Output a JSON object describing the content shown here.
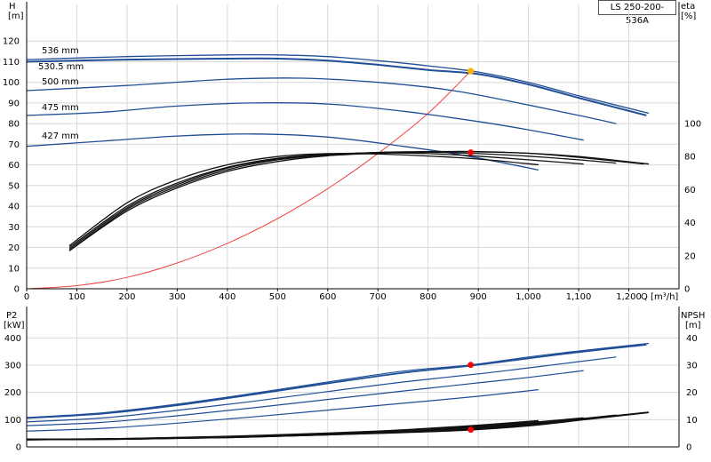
{
  "product_label": "LS 250-200-536A",
  "colors": {
    "curve_blue": "#1f4e96",
    "eff_black": "#111111",
    "system_red": "#ee4444",
    "marker_red": "#ff0000",
    "marker_orange": "#ffb300",
    "grid": "#d8d8d8",
    "axis": "#000000"
  },
  "chart_data": [
    {
      "type": "line",
      "title": "",
      "x_label": "Q [m³/h]",
      "x_ticks": [
        "0",
        "100",
        "200",
        "300",
        "400",
        "500",
        "600",
        "700",
        "800",
        "900",
        "1,000",
        "1,100",
        "1,200"
      ],
      "xlim": [
        0,
        1300
      ],
      "left_axis": {
        "label": "H",
        "unit": "[m]",
        "ticks": [
          "0",
          "10",
          "20",
          "30",
          "40",
          "50",
          "60",
          "70",
          "80",
          "90",
          "100",
          "110",
          "120"
        ],
        "range": [
          0,
          130
        ]
      },
      "right_axis": {
        "label": "eta",
        "unit": "[%]",
        "ticks": [
          "0",
          "20",
          "40",
          "60",
          "80",
          "100"
        ],
        "range": [
          0,
          100
        ]
      },
      "grid": true,
      "head_curves": [
        {
          "name": "536 mm",
          "points": [
            [
              0,
              111
            ],
            [
              200,
              112.5
            ],
            [
              400,
              113.3
            ],
            [
              500,
              113.3
            ],
            [
              600,
              112.5
            ],
            [
              700,
              110.5
            ],
            [
              800,
              108
            ],
            [
              900,
              105
            ],
            [
              1000,
              100
            ],
            [
              1100,
              93.5
            ],
            [
              1240,
              85
            ]
          ]
        },
        {
          "name": "530.5 mm",
          "points": [
            [
              0,
              110
            ],
            [
              200,
              111
            ],
            [
              400,
              111.5
            ],
            [
              500,
              111.5
            ],
            [
              600,
              110.5
            ],
            [
              700,
              108.5
            ],
            [
              800,
              106
            ],
            [
              900,
              104
            ],
            [
              1000,
              99
            ],
            [
              1100,
              92.5
            ],
            [
              1235,
              84
            ]
          ]
        },
        {
          "name": "500 mm",
          "points": [
            [
              0,
              96
            ],
            [
              200,
              98.5
            ],
            [
              400,
              101.5
            ],
            [
              550,
              102
            ],
            [
              700,
              100
            ],
            [
              850,
              96
            ],
            [
              1000,
              89
            ],
            [
              1100,
              84
            ],
            [
              1175,
              80
            ]
          ]
        },
        {
          "name": "475 mm",
          "points": [
            [
              0,
              84
            ],
            [
              150,
              85.5
            ],
            [
              300,
              88.5
            ],
            [
              450,
              90
            ],
            [
              600,
              89.5
            ],
            [
              750,
              86
            ],
            [
              900,
              81
            ],
            [
              1000,
              77
            ],
            [
              1110,
              72
            ]
          ]
        },
        {
          "name": "427 mm",
          "points": [
            [
              0,
              69
            ],
            [
              150,
              71.5
            ],
            [
              300,
              74
            ],
            [
              450,
              75
            ],
            [
              600,
              73.5
            ],
            [
              750,
              69
            ],
            [
              850,
              65.5
            ],
            [
              950,
              61
            ],
            [
              1020,
              57.5
            ]
          ]
        }
      ],
      "efficiency_curves": [
        {
          "points": [
            [
              85,
              23
            ],
            [
              200,
              48
            ],
            [
              300,
              62
            ],
            [
              400,
              72
            ],
            [
              500,
              78
            ],
            [
              600,
              81
            ],
            [
              700,
              82.5
            ],
            [
              800,
              83
            ],
            [
              900,
              83
            ],
            [
              1000,
              82
            ],
            [
              1100,
              80
            ],
            [
              1240,
              75.5
            ]
          ]
        },
        {
          "points": [
            [
              85,
              23
            ],
            [
              200,
              47
            ],
            [
              300,
              61
            ],
            [
              400,
              71
            ],
            [
              500,
              77
            ],
            [
              600,
              80.5
            ],
            [
              700,
              82
            ],
            [
              800,
              82.8
            ],
            [
              900,
              82.8
            ],
            [
              1000,
              82
            ],
            [
              1100,
              79.5
            ],
            [
              1230,
              75.5
            ]
          ]
        },
        {
          "points": [
            [
              85,
              24
            ],
            [
              200,
              49
            ],
            [
              300,
              63
            ],
            [
              400,
              73
            ],
            [
              500,
              78.5
            ],
            [
              600,
              81
            ],
            [
              700,
              82.5
            ],
            [
              800,
              82.6
            ],
            [
              900,
              81.8
            ],
            [
              1000,
              80.2
            ],
            [
              1100,
              78
            ],
            [
              1175,
              76
            ]
          ]
        },
        {
          "points": [
            [
              85,
              25
            ],
            [
              200,
              50
            ],
            [
              300,
              64
            ],
            [
              400,
              73.5
            ],
            [
              500,
              79
            ],
            [
              600,
              81.5
            ],
            [
              700,
              82.2
            ],
            [
              800,
              81.8
            ],
            [
              900,
              80.2
            ],
            [
              1000,
              78
            ],
            [
              1110,
              75.5
            ]
          ]
        },
        {
          "points": [
            [
              85,
              26
            ],
            [
              200,
              52
            ],
            [
              300,
              66
            ],
            [
              400,
              75
            ],
            [
              500,
              80
            ],
            [
              600,
              81.8
            ],
            [
              700,
              81.5
            ],
            [
              800,
              80.3
            ],
            [
              900,
              78.5
            ],
            [
              1020,
              75
            ]
          ]
        }
      ],
      "system_curve": {
        "points": [
          [
            0,
            0
          ],
          [
            100,
            1.5
          ],
          [
            200,
            5.5
          ],
          [
            300,
            12.5
          ],
          [
            400,
            22
          ],
          [
            500,
            34
          ],
          [
            600,
            48.5
          ],
          [
            700,
            65.5
          ],
          [
            800,
            85
          ],
          [
            885,
            105.5
          ]
        ]
      },
      "duty_point": {
        "Q": 885,
        "H": 105.5,
        "eta": 82.5
      }
    },
    {
      "type": "line",
      "title": "",
      "x_label": "",
      "xlim": [
        0,
        1300
      ],
      "left_axis": {
        "label": "P2",
        "unit": "[kW]",
        "ticks": [
          "0",
          "100",
          "200",
          "300",
          "400"
        ],
        "range": [
          0,
          450
        ]
      },
      "right_axis": {
        "label": "NPSH",
        "unit": "[m]",
        "ticks": [
          "0",
          "10",
          "20",
          "30",
          "40"
        ],
        "range": [
          0,
          45
        ]
      },
      "grid": true,
      "power_curves": [
        {
          "points": [
            [
              0,
              108
            ],
            [
              150,
              125
            ],
            [
              300,
              157
            ],
            [
              450,
              196
            ],
            [
              600,
              238
            ],
            [
              750,
              278
            ],
            [
              885,
              301
            ],
            [
              1000,
              330
            ],
            [
              1100,
              352
            ],
            [
              1240,
              380
            ]
          ]
        },
        {
          "points": [
            [
              0,
              106
            ],
            [
              150,
              122
            ],
            [
              300,
              153
            ],
            [
              450,
              192
            ],
            [
              600,
              233
            ],
            [
              750,
              272
            ],
            [
              885,
              298
            ],
            [
              1000,
              325
            ],
            [
              1100,
              348
            ],
            [
              1235,
              375
            ]
          ]
        },
        {
          "points": [
            [
              0,
              92
            ],
            [
              150,
              106
            ],
            [
              300,
              134
            ],
            [
              450,
              167
            ],
            [
              600,
              203
            ],
            [
              750,
              238
            ],
            [
              900,
              268
            ],
            [
              1000,
              290
            ],
            [
              1175,
              330
            ]
          ]
        },
        {
          "points": [
            [
              0,
              78
            ],
            [
              150,
              90
            ],
            [
              300,
              114
            ],
            [
              450,
              143
            ],
            [
              600,
              174
            ],
            [
              750,
              205
            ],
            [
              900,
              235
            ],
            [
              1000,
              255
            ],
            [
              1110,
              280
            ]
          ]
        },
        {
          "points": [
            [
              0,
              58
            ],
            [
              150,
              68
            ],
            [
              300,
              87
            ],
            [
              450,
              110
            ],
            [
              600,
              135
            ],
            [
              750,
              160
            ],
            [
              900,
              186
            ],
            [
              1020,
              210
            ]
          ]
        }
      ],
      "npsh_curves": [
        {
          "points": [
            [
              0,
              2.7
            ],
            [
              200,
              2.9
            ],
            [
              400,
              3.5
            ],
            [
              600,
              4.5
            ],
            [
              750,
              5.3
            ],
            [
              885,
              6.3
            ],
            [
              1000,
              7.8
            ],
            [
              1100,
              9.8
            ],
            [
              1240,
              12.7
            ]
          ]
        },
        {
          "points": [
            [
              0,
              2.7
            ],
            [
              200,
              2.9
            ],
            [
              400,
              3.5
            ],
            [
              600,
              4.5
            ],
            [
              750,
              5.4
            ],
            [
              885,
              6.4
            ],
            [
              1000,
              8.0
            ],
            [
              1100,
              10.0
            ],
            [
              1235,
              12.6
            ]
          ]
        },
        {
          "points": [
            [
              0,
              2.7
            ],
            [
              200,
              2.9
            ],
            [
              400,
              3.6
            ],
            [
              600,
              4.6
            ],
            [
              750,
              5.6
            ],
            [
              900,
              7.0
            ],
            [
              1000,
              8.4
            ],
            [
              1100,
              10.2
            ],
            [
              1175,
              11.6
            ]
          ]
        },
        {
          "points": [
            [
              0,
              2.7
            ],
            [
              200,
              3.0
            ],
            [
              400,
              3.7
            ],
            [
              600,
              4.8
            ],
            [
              750,
              5.9
            ],
            [
              900,
              7.4
            ],
            [
              1000,
              8.8
            ],
            [
              1110,
              10.6
            ]
          ]
        },
        {
          "points": [
            [
              0,
              2.7
            ],
            [
              200,
              3.0
            ],
            [
              400,
              3.8
            ],
            [
              600,
              5.0
            ],
            [
              750,
              6.2
            ],
            [
              900,
              7.9
            ],
            [
              1020,
              9.6
            ]
          ]
        }
      ],
      "duty_point": {
        "Q": 885,
        "P2": 301,
        "NPSH": 6.3
      }
    }
  ]
}
